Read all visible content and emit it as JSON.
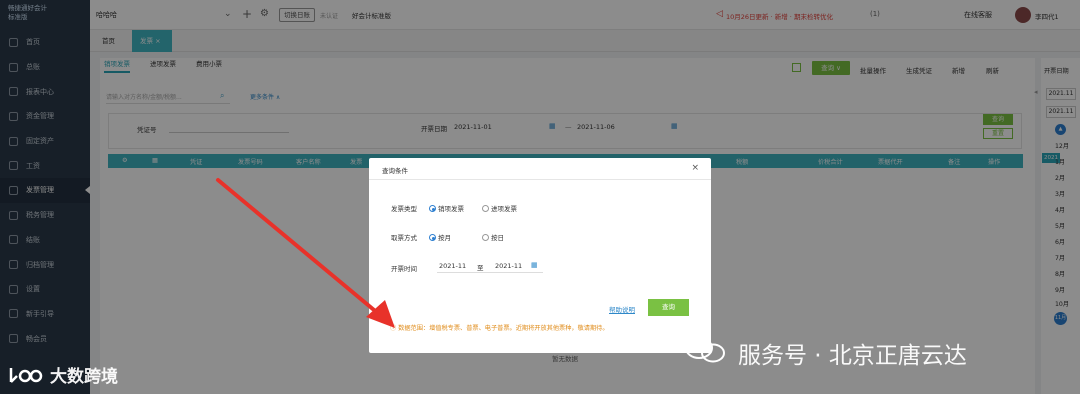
{
  "sidebar": {
    "logo_line1": "畅捷通好会计",
    "logo_line2": "标准版",
    "items": [
      {
        "label": "首页"
      },
      {
        "label": "总账"
      },
      {
        "label": "报表中心"
      },
      {
        "label": "资金管理"
      },
      {
        "label": "固定资产"
      },
      {
        "label": "工资"
      },
      {
        "label": "发票管理"
      },
      {
        "label": "税务管理"
      },
      {
        "label": "结账"
      },
      {
        "label": "归档管理"
      },
      {
        "label": "设置"
      },
      {
        "label": "新手引导"
      },
      {
        "label": "畅会员"
      }
    ]
  },
  "topbar": {
    "company": "哈哈哈",
    "switch_period": "切换日账",
    "unverified": "未认证",
    "standard": "好会计标准版",
    "notice": "10月26日更新 · 新增 · 期末检转优化",
    "message_count": "(1)",
    "online_service": "在线客服",
    "username": "李四代1"
  },
  "tabs": {
    "home": "首页",
    "invoice": "发票 ×"
  },
  "subtabs": {
    "sales": "销项发票",
    "input": "进项发票",
    "expense": "费用小票"
  },
  "toolbar": {
    "query": "查询 ∨",
    "batch": "批量操作",
    "generate": "生成凭证",
    "add": "新增",
    "refresh": "刷新"
  },
  "search": {
    "placeholder": "请输入对方名称/金额/税额...",
    "more_conditions": "更多条件 ∧"
  },
  "filter": {
    "voucher_label": "凭证号",
    "date_label": "开票日期",
    "date_from": "2021-11-01",
    "date_to": "2021-11-06",
    "dash": "—",
    "search_btn": "查询",
    "reset_btn": "重置"
  },
  "table": {
    "headers": [
      "⚙",
      "▦",
      "凭证",
      "",
      "发票号码",
      "客户名称",
      "发票",
      "税额",
      "价税合计",
      "票据代开",
      "备注",
      "操作"
    ],
    "no_data": "暂无数据"
  },
  "rightpanel": {
    "open_invoice": "开票日期",
    "date_top": "2021.11",
    "date_bottom": "2021.11",
    "year_badge": "2021",
    "months": [
      "12月",
      "1月",
      "2月",
      "3月",
      "4月",
      "5月",
      "6月",
      "7月",
      "8月",
      "9月",
      "10月"
    ],
    "current_month": "11月"
  },
  "modal": {
    "title": "查询条件",
    "close": "×",
    "invoice_type_label": "发票类型",
    "invoice_type_options": [
      "销项发票",
      "进项发票"
    ],
    "fetch_mode_label": "取票方式",
    "fetch_mode_options": [
      "按月",
      "按日"
    ],
    "issue_time_label": "开票时间",
    "time_from": "2021-11",
    "time_to_label": "至",
    "time_to": "2021-11",
    "help": "帮助说明",
    "query": "查询",
    "data_scope": "ⓘ 数据范围：增值税专票、普票、电子普票。近期将开放其他票种，敬请期待。"
  },
  "watermarks": {
    "left": "大数跨境",
    "right": "服务号 · 北京正唐云达"
  },
  "colors": {
    "sidebar_bg": "#2b3a4a",
    "accent_teal": "#40b7c4",
    "accent_green": "#7ac143",
    "arrow_red": "#e8322a",
    "warning_orange": "#e08c1a"
  }
}
